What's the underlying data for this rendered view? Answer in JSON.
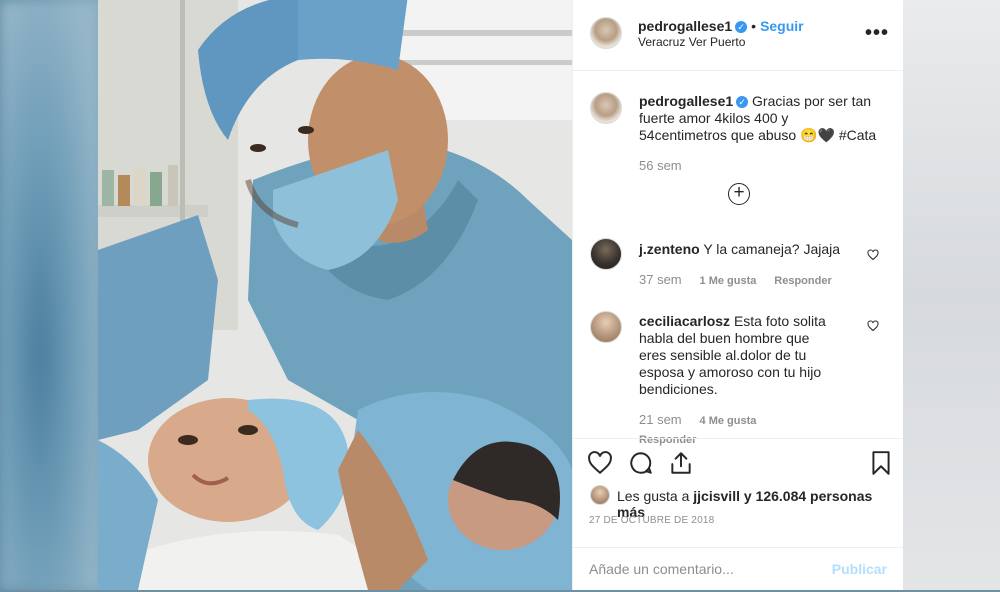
{
  "post": {
    "username": "pedrogallese1",
    "verified_mark": "✓",
    "separator": "•",
    "follow_label": "Seguir",
    "location": "Veracruz Ver Puerto",
    "more_label": "•••"
  },
  "caption": {
    "username": "pedrogallese1",
    "text": "Gracias por ser tan fuerte amor 4kilos 400 y 54centimetros que abuso 😁🖤 #Cata",
    "time": "56 sem"
  },
  "load_more_label": "+",
  "comments": [
    {
      "username": "j.zenteno",
      "text": "Y la camaneja? Jajaja",
      "time": "37 sem",
      "likes": "1 Me gusta",
      "reply": "Responder"
    },
    {
      "username": "ceciliacarlosz",
      "text": "Esta foto solita habla del buen hombre que eres sensible al.dolor de tu esposa y amoroso con tu hijo bendiciones.",
      "time": "21 sem",
      "likes": "4 Me gusta",
      "reply": "Responder"
    }
  ],
  "actions": {
    "icons": [
      "heart-icon",
      "comment-icon",
      "share-icon",
      "bookmark-icon"
    ],
    "likes_prefix": "Les gusta a ",
    "likes_user": "jjcisvill",
    "likes_suffix": " y 126.084 personas más",
    "date": "27 DE OCTUBRE DE 2018"
  },
  "comment_box": {
    "placeholder": "Añade un comentario...",
    "publish_label": "Publicar"
  },
  "colors": {
    "accent": "#3897f0",
    "text": "#262626",
    "muted": "#8e8e8e",
    "scrubs": "#6fa3bd"
  }
}
